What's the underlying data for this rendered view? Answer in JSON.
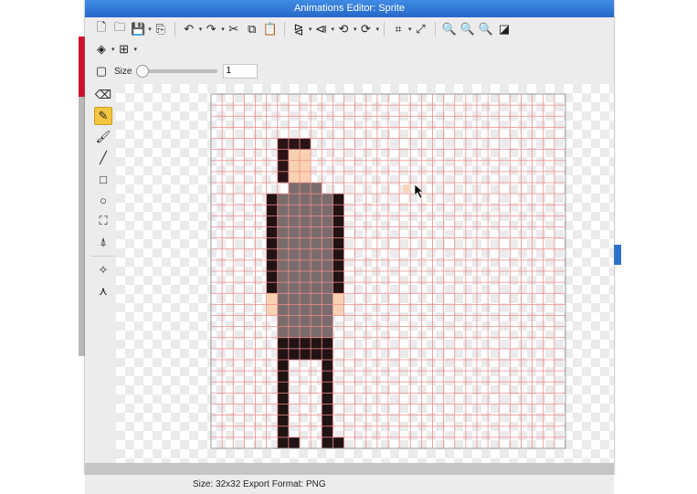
{
  "window": {
    "title": "Animations Editor: Sprite"
  },
  "toolbar": {
    "row1": [
      {
        "name": "new-file-icon",
        "glyph": "🗋",
        "caret": false
      },
      {
        "name": "open-folder-icon",
        "glyph": "🗀",
        "caret": false
      },
      {
        "name": "save-icon",
        "glyph": "💾",
        "caret": true
      },
      {
        "name": "export-icon",
        "glyph": "⎘",
        "caret": false
      },
      {
        "sep": true
      },
      {
        "name": "undo-icon",
        "glyph": "↶",
        "caret": true
      },
      {
        "name": "redo-icon",
        "glyph": "↷",
        "caret": true
      },
      {
        "name": "cut-icon",
        "glyph": "✂",
        "caret": false
      },
      {
        "name": "copy-icon",
        "glyph": "⧉",
        "caret": false
      },
      {
        "name": "paste-icon",
        "glyph": "📋",
        "caret": false
      },
      {
        "sep": true
      },
      {
        "name": "flip-horizontal-icon",
        "glyph": "⧎",
        "caret": true
      },
      {
        "name": "flip-vertical-icon",
        "glyph": "⧏",
        "caret": true
      },
      {
        "name": "rotate-left-icon",
        "glyph": "⟲",
        "caret": true
      },
      {
        "name": "rotate-right-icon",
        "glyph": "⟳",
        "caret": true
      },
      {
        "sep": true
      },
      {
        "name": "crop-icon",
        "glyph": "⌗",
        "caret": true
      },
      {
        "name": "resize-icon",
        "glyph": "⤢",
        "caret": false
      },
      {
        "sep": true
      },
      {
        "name": "zoom-in-icon",
        "glyph": "🔍",
        "caret": false
      },
      {
        "name": "zoom-out-icon",
        "glyph": "🔍",
        "caret": false
      },
      {
        "name": "zoom-fit-icon",
        "glyph": "🔍",
        "caret": false
      },
      {
        "name": "toggle-background-icon",
        "glyph": "◪",
        "caret": false
      }
    ],
    "row2": [
      {
        "name": "layers-icon",
        "glyph": "◈",
        "caret": true
      },
      {
        "name": "grid-icon",
        "glyph": "⊞",
        "caret": true
      }
    ],
    "selection_icon": "▢",
    "size_label": "Size",
    "size_value": "1",
    "size_slider_fraction": 0
  },
  "sidebar": {
    "tools": [
      {
        "name": "eraser-tool-icon",
        "glyph": "⌫",
        "active": false
      },
      {
        "name": "pencil-tool-icon",
        "glyph": "✎",
        "active": true
      },
      {
        "name": "brush-tool-icon",
        "glyph": "🖌",
        "active": false
      },
      {
        "name": "line-tool-icon",
        "glyph": "╱",
        "active": false
      },
      {
        "name": "rectangle-tool-icon",
        "glyph": "□",
        "active": false
      },
      {
        "name": "ellipse-tool-icon",
        "glyph": "○",
        "active": false
      },
      {
        "name": "fill-bucket-tool-icon",
        "glyph": "⛶",
        "active": false
      },
      {
        "name": "eyedropper-tool-icon",
        "glyph": "⍋",
        "active": false
      },
      {
        "sep": true
      },
      {
        "name": "origin-point-tool-icon",
        "glyph": "✧",
        "active": false
      },
      {
        "name": "attach-points-tool-icon",
        "glyph": "⋏",
        "active": false
      }
    ]
  },
  "canvas": {
    "grid_cols": 32,
    "grid_rows": 32,
    "grid_color": "#f28c8c",
    "pixel_colors": {
      "H": "#2b1418",
      "S": "#f8d2b0",
      "G": "#7a6c6c",
      "D": "#211314"
    },
    "sprite_rows": [
      "................................",
      "................................",
      "................................",
      "................................",
      "......HHH.......................",
      "......HSS.......................",
      "......HSS.......................",
      "......HSS.......................",
      ".......GGG......................",
      ".....DGGGGGD....................",
      ".....DGGGGGD....................",
      ".....DGGGGGD....................",
      ".....DGGGGGD....................",
      ".....DGGGGGD....................",
      ".....DGGGGGD....................",
      ".....DGGGGGD....................",
      ".....DGGGGGD....................",
      ".....DGGGGGD....................",
      ".....SGGGGGS....................",
      ".....SGGGGGS....................",
      "......GGGGG.....................",
      "......GGGGG.....................",
      "......DDDDD.....................",
      "......DDDDD.....................",
      "......D...D.....................",
      "......D...D.....................",
      "......D...D.....................",
      "......D...D.....................",
      "......D...D.....................",
      "......D...D.....................",
      "......D...D.....................",
      "......DD..DD...................."
    ]
  },
  "statusbar": {
    "text": "Size: 32x32   Export Format: PNG"
  }
}
